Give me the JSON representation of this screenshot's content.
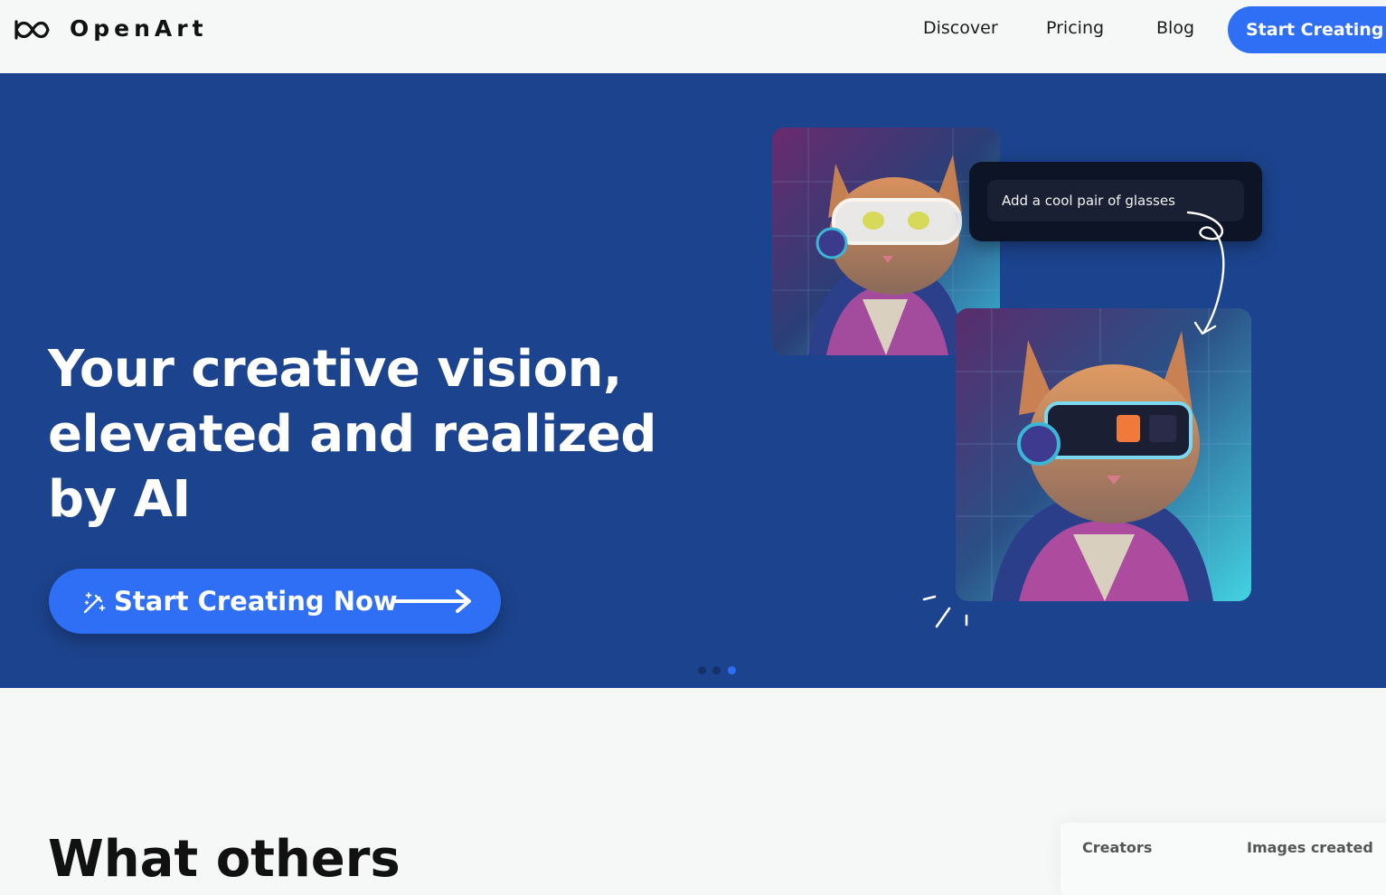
{
  "header": {
    "brand": "OpenArt",
    "nav": [
      {
        "label": "Discover"
      },
      {
        "label": "Pricing"
      },
      {
        "label": "Blog"
      }
    ],
    "cta_label": "Start Creating Now"
  },
  "hero": {
    "title": "Your creative vision,\nelevated and realized\nby AI",
    "cta_label": "Start Creating Now",
    "prompt_text": "Add a cool pair of glasses",
    "carousel": {
      "count": 3,
      "active_index": 3
    }
  },
  "section": {
    "title": "What others"
  },
  "stats": {
    "labels": [
      "Creators",
      "Images created"
    ]
  },
  "colors": {
    "accent": "#2f6ff5",
    "hero_bg": "#1c438d",
    "dot_inactive": "#16306a"
  },
  "icons": {
    "logo": "infinity-logo-icon",
    "cta": "magic-wand-icon",
    "arrow": "arrow-right-icon"
  }
}
